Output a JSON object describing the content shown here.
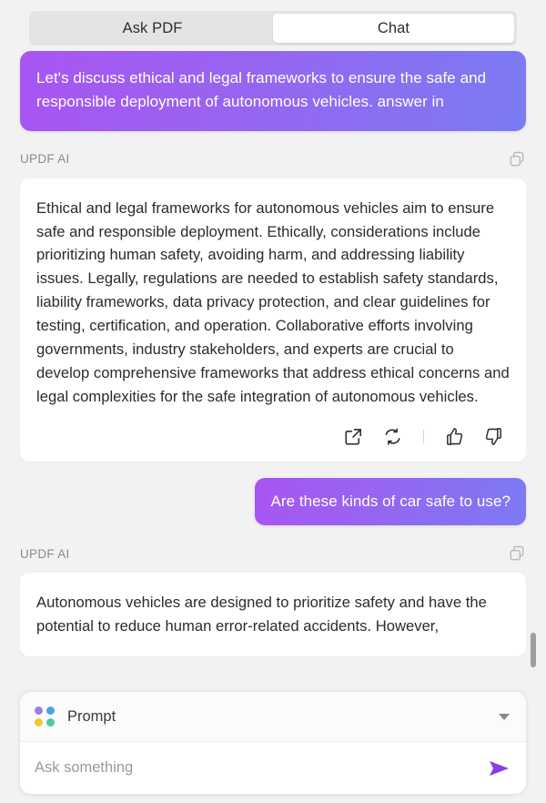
{
  "tabs": [
    {
      "label": "Ask PDF",
      "active": false
    },
    {
      "label": "Chat",
      "active": true
    }
  ],
  "conversation": {
    "user_message_1": "Let's discuss ethical and legal frameworks to ensure the safe and responsible deployment of autonomous vehicles. answer in",
    "ai_label_1": "UPDF AI",
    "ai_message_1": "Ethical and legal frameworks for autonomous vehicles aim to ensure safe and responsible deployment. Ethically, considerations include prioritizing human safety, avoiding harm, and addressing liability issues. Legally, regulations are needed to establish safety standards, liability frameworks, data privacy protection, and clear guidelines for testing, certification, and operation. Collaborative efforts involving governments, industry stakeholders, and experts are crucial to develop comprehensive frameworks that address ethical concerns and legal complexities for the safe integration of autonomous vehicles.",
    "user_message_2": "Are these kinds of car safe to use?",
    "ai_label_2": "UPDF AI",
    "ai_message_2": "Autonomous vehicles are designed to prioritize safety and have the potential to reduce human error-related accidents. However,"
  },
  "actions": {
    "copy": "copy-icon",
    "share": "external-link-icon",
    "regenerate": "refresh-icon",
    "like": "thumbs-up-icon",
    "dislike": "thumbs-down-icon"
  },
  "composer": {
    "prompt_label": "Prompt",
    "prompt_caret": "chevron-down-icon",
    "input_value": "",
    "input_placeholder": "Ask something",
    "send_icon": "send-icon"
  },
  "colors": {
    "bubble_gradient_start": "#a855f2",
    "bubble_gradient_end": "#7b7bf2",
    "send_purple": "#8b3de8",
    "dot_purple": "#9b7ce8",
    "dot_blue": "#4ba3e3",
    "dot_yellow": "#f4c534",
    "dot_teal": "#4cc9a8",
    "page_background": "#f2f2f2",
    "tabbar_background": "#e4e4e4"
  }
}
